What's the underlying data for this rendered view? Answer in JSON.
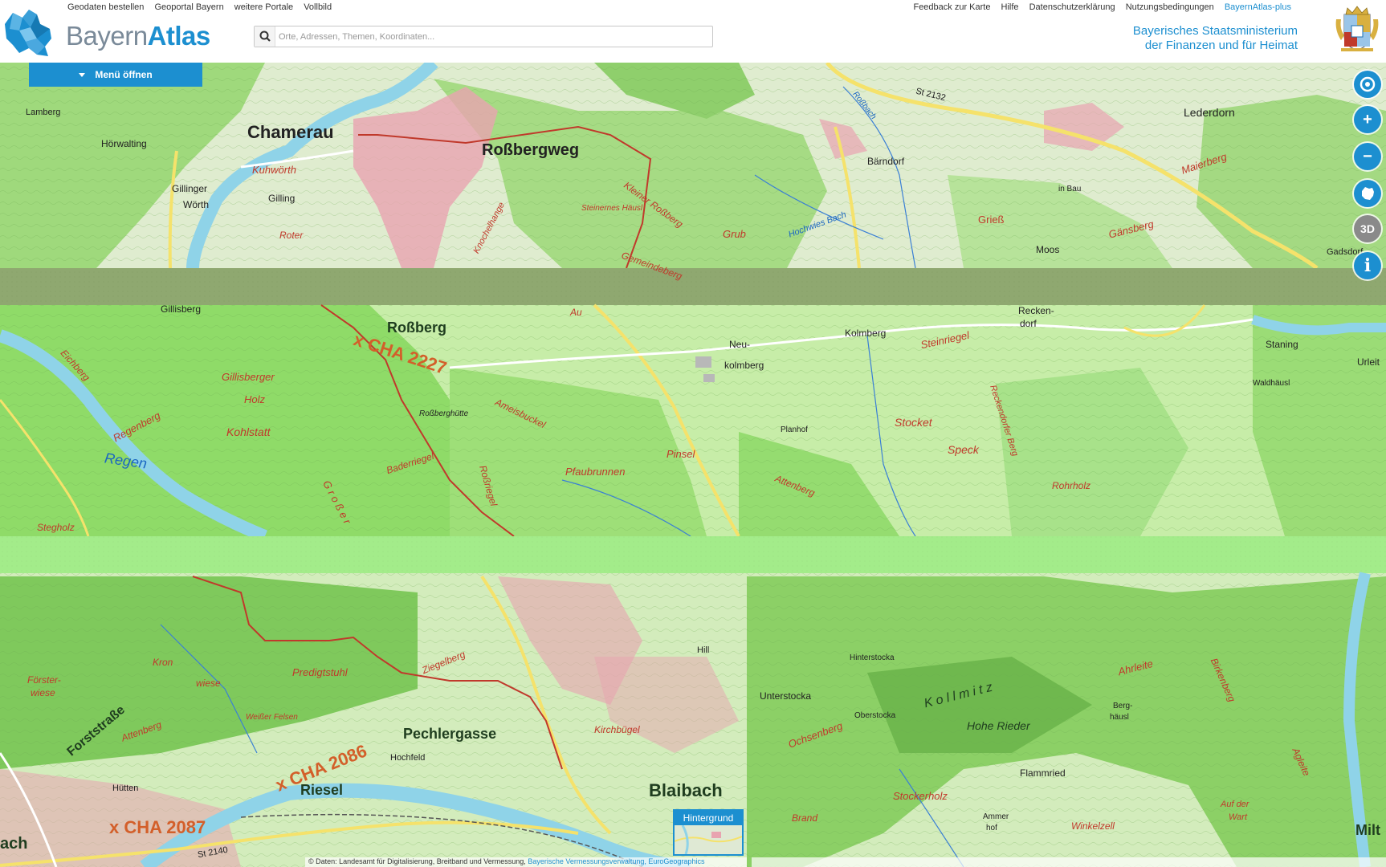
{
  "header": {
    "left_links": [
      "Geodaten bestellen",
      "Geoportal Bayern",
      "weitere Portale",
      "Vollbild"
    ],
    "right_links": [
      "Feedback zur Karte",
      "Hilfe",
      "Datenschutzerklärung",
      "Nutzungsbedingungen",
      "BayernAtlas-plus"
    ],
    "logo_part1": "Bayern",
    "logo_part2": "Atlas",
    "ministry_line1": "Bayerisches Staatsministerium",
    "ministry_line2": "der Finanzen und für Heimat"
  },
  "search": {
    "placeholder": "Orte, Adressen, Themen, Koordinaten..."
  },
  "menu": {
    "label": "Menü öffnen"
  },
  "tools": {
    "zoom_in": "+",
    "zoom_out": "−",
    "three_d": "3D",
    "info": "i"
  },
  "background": {
    "label": "Hintergrund"
  },
  "attribution": {
    "text": "© Daten: Landesamt für Digitalisierung, Breitband und Vermessung,",
    "link1": "Bayerische Vermessungsverwaltung,",
    "link2": "EuroGeographics"
  },
  "colors": {
    "accent": "#1c8fd0",
    "forest": "#9fd97c",
    "forest_dark": "#7fbf5e",
    "river": "#8fd3e8",
    "road": "#f5e26b",
    "town": "#e8a4b0",
    "route": "#c0392b",
    "band": "#8fa870"
  },
  "map_labels": {
    "top": [
      {
        "id": "chamerau",
        "text": "Chamerau"
      },
      {
        "id": "rossbergweg",
        "text": "Roßbergweg"
      },
      {
        "id": "lederdorn",
        "text": "Lederdorn"
      },
      {
        "id": "hoerwalting",
        "text": "Hörwalting"
      },
      {
        "id": "kuhwoerth",
        "text": "Kuhwörth"
      },
      {
        "id": "gillinger-woerth",
        "text": "Gillinger"
      },
      {
        "id": "woerth",
        "text": "Wörth"
      },
      {
        "id": "gilling",
        "text": "Gilling"
      },
      {
        "id": "lamberg",
        "text": "Lamberg"
      },
      {
        "id": "baerndorf",
        "text": "Bärndorf"
      },
      {
        "id": "griess",
        "text": "Grieß"
      },
      {
        "id": "moos",
        "text": "Moos"
      },
      {
        "id": "gadsdorf",
        "text": "Gadsdorf"
      },
      {
        "id": "gaensberg",
        "text": "Gänsberg"
      },
      {
        "id": "maierberg",
        "text": "Maierberg"
      },
      {
        "id": "kleiner-rossberg",
        "text": "Kleiner Roßberg"
      },
      {
        "id": "gemeindeberg",
        "text": "Gemeindeberg"
      },
      {
        "id": "knochelhange",
        "text": "Knochelhange"
      },
      {
        "id": "steinernes-haeusl",
        "text": "Steinernes Häusl"
      },
      {
        "id": "st2132",
        "text": "St 2132"
      },
      {
        "id": "hochwies-bach",
        "text": "Hochwies Bach"
      },
      {
        "id": "rossbach",
        "text": "Roßbach"
      },
      {
        "id": "in-bau",
        "text": "in Bau"
      },
      {
        "id": "roter-haar",
        "text": "Roter"
      },
      {
        "id": "grub",
        "text": "Grub"
      }
    ],
    "middle": [
      {
        "id": "gillisberg",
        "text": "Gillisberg"
      },
      {
        "id": "rossberg",
        "text": "Roßberg"
      },
      {
        "id": "cha2227",
        "text": "x CHA 2227"
      },
      {
        "id": "regen",
        "text": "Regen"
      },
      {
        "id": "regenberg",
        "text": "Regenberg"
      },
      {
        "id": "kohlstatt",
        "text": "Kohlstatt"
      },
      {
        "id": "eichberg",
        "text": "Eichberg"
      },
      {
        "id": "gillisberger-holz",
        "text": "Gillisberger"
      },
      {
        "id": "holz",
        "text": "Holz"
      },
      {
        "id": "stegholz",
        "text": "Stegholz"
      },
      {
        "id": "ameisbuckel",
        "text": "Ameisbuckel"
      },
      {
        "id": "rossberghuette",
        "text": "Roßberghütte"
      },
      {
        "id": "baderriegel",
        "text": "Baderriegel"
      },
      {
        "id": "rossriegel",
        "text": "Roßriegel"
      },
      {
        "id": "grosser",
        "text": "G r o ß e r"
      },
      {
        "id": "pfaubrunnen",
        "text": "Pfaubrunnen"
      },
      {
        "id": "pinsel-holz",
        "text": "Pinsel"
      },
      {
        "id": "neu-kolmberg",
        "text": "Neu-"
      },
      {
        "id": "kolmberg2",
        "text": "kolmberg"
      },
      {
        "id": "kolmberg",
        "text": "Kolmberg"
      },
      {
        "id": "steinriegel",
        "text": "Steinriegel"
      },
      {
        "id": "reckendorf",
        "text": "Recken-"
      },
      {
        "id": "dorf",
        "text": "dorf"
      },
      {
        "id": "staning",
        "text": "Staning"
      },
      {
        "id": "waldhaeusl",
        "text": "Waldhäusl"
      },
      {
        "id": "urleit",
        "text": "Urleit"
      },
      {
        "id": "planhof",
        "text": "Planhof"
      },
      {
        "id": "stocket",
        "text": "Stocket"
      },
      {
        "id": "speck",
        "text": "Speck"
      },
      {
        "id": "reckendorfer-berg",
        "text": "Reckendorfer Berg"
      },
      {
        "id": "rohrholz",
        "text": "Rohrholz"
      },
      {
        "id": "attenberg",
        "text": "Attenberg"
      },
      {
        "id": "au",
        "text": "Au"
      }
    ],
    "bottom": [
      {
        "id": "forstwiese",
        "text": "Förster-"
      },
      {
        "id": "wiese",
        "text": "wiese"
      },
      {
        "id": "kronwiese",
        "text": "Kron"
      },
      {
        "id": "kronwiese2",
        "text": "wiese"
      },
      {
        "id": "predigtstuhl",
        "text": "Predigtstuhl"
      },
      {
        "id": "ziegelberg",
        "text": "Ziegelberg"
      },
      {
        "id": "hill",
        "text": "Hill"
      },
      {
        "id": "forststrasse",
        "text": "Forststraße"
      },
      {
        "id": "attenberg2",
        "text": "Attenberg"
      },
      {
        "id": "weisser-felsen",
        "text": "Weißer Felsen"
      },
      {
        "id": "pechlergasse",
        "text": "Pechlergasse"
      },
      {
        "id": "hochfeld",
        "text": "Hochfeld"
      },
      {
        "id": "kirchbuegel",
        "text": "Kirchbügel"
      },
      {
        "id": "blaibach",
        "text": "Blaibach"
      },
      {
        "id": "cha2086",
        "text": "x CHA 2086"
      },
      {
        "id": "riesel",
        "text": "Riesel"
      },
      {
        "id": "huetten",
        "text": "Hütten"
      },
      {
        "id": "cha2087",
        "text": "x CHA 2087"
      },
      {
        "id": "st2140",
        "text": "St 2140"
      },
      {
        "id": "ach",
        "text": "ach"
      },
      {
        "id": "unterstocka",
        "text": "Unterstocka"
      },
      {
        "id": "hinterstocka",
        "text": "Hinterstocka"
      },
      {
        "id": "oberstocka",
        "text": "Oberstocka"
      },
      {
        "id": "ochsenberg",
        "text": "Ochsenberg"
      },
      {
        "id": "kollmitz",
        "text": "K o l l m i t z"
      },
      {
        "id": "ahrleite",
        "text": "Ahrleite"
      },
      {
        "id": "birkenberg",
        "text": "Birkenberg"
      },
      {
        "id": "hohe-rieder",
        "text": "Hohe Rieder"
      },
      {
        "id": "berghaeusl",
        "text": "Berg-"
      },
      {
        "id": "haeusl",
        "text": "häusl"
      },
      {
        "id": "flammried",
        "text": "Flammried"
      },
      {
        "id": "stockerholz",
        "text": "Stockerholz"
      },
      {
        "id": "brand",
        "text": "Brand"
      },
      {
        "id": "ammerhof",
        "text": "Ammer"
      },
      {
        "id": "hof",
        "text": "hof"
      },
      {
        "id": "winkelzell",
        "text": "Winkelzell"
      },
      {
        "id": "auf-der-wart",
        "text": "Auf der"
      },
      {
        "id": "wart",
        "text": "Wart"
      },
      {
        "id": "agleite",
        "text": "Agleite"
      },
      {
        "id": "milt",
        "text": "Milt"
      }
    ]
  }
}
